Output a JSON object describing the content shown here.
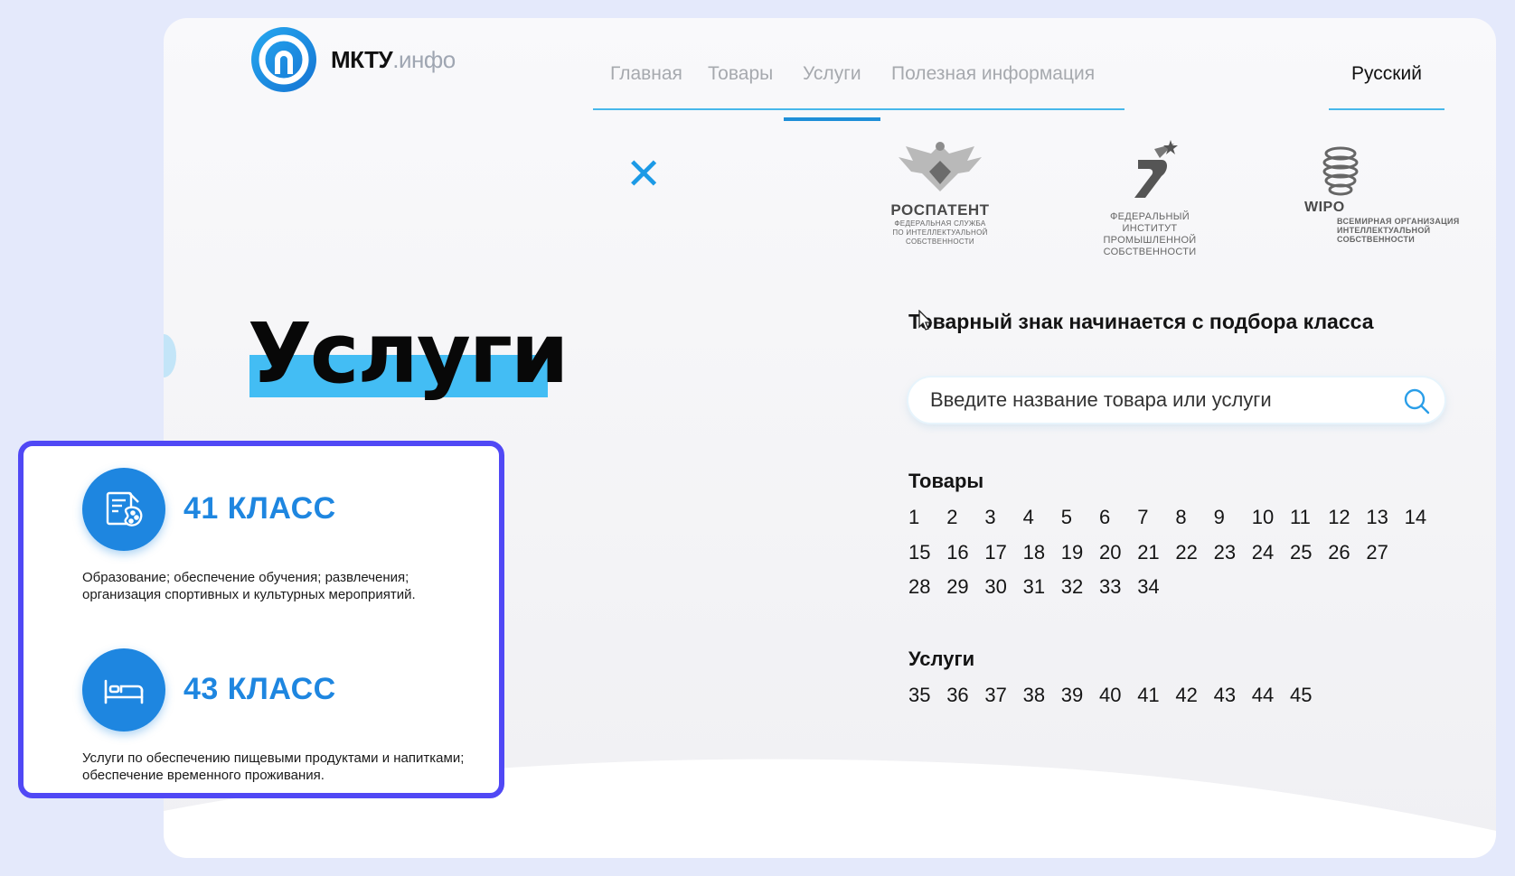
{
  "header": {
    "logo_main": "МКТУ",
    "logo_suffix": ".инфо",
    "nav": [
      "Главная",
      "Товары",
      "Услуги",
      "Полезная информация"
    ],
    "language": "Русский"
  },
  "partners": {
    "rospatent": {
      "name": "РОСПАТЕНТ",
      "sub": [
        "ФЕДЕРАЛЬНАЯ СЛУЖБА",
        "ПО ИНТЕЛЛЕКТУАЛЬНОЙ",
        "СОБСТВЕННОСТИ"
      ]
    },
    "fips": {
      "sub": [
        "ФЕДЕРАЛЬНЫЙ ИНСТИТУТ",
        "ПРОМЫШЛЕННОЙ",
        "СОБСТВЕННОСТИ"
      ]
    },
    "wipo": {
      "name": "WIPO",
      "sub": [
        "ВСЕМИРНАЯ ОРГАНИЗАЦИЯ",
        "ИНТЕЛЛЕКТУАЛЬНОЙ",
        "СОБСТВЕННОСТИ"
      ]
    }
  },
  "hero": {
    "title": "Услуги"
  },
  "search": {
    "tagline": "Товарный знак начинается с подбора класса",
    "placeholder": "Введите название товара или услуги"
  },
  "goods": {
    "heading": "Товары",
    "rows": [
      [
        "1",
        "2",
        "3",
        "4",
        "5",
        "6",
        "7",
        "8",
        "9",
        "10",
        "11",
        "12",
        "13",
        "14"
      ],
      [
        "15",
        "16",
        "17",
        "18",
        "19",
        "20",
        "21",
        "22",
        "23",
        "24",
        "25",
        "26",
        "27"
      ],
      [
        "28",
        "29",
        "30",
        "31",
        "32",
        "33",
        "34"
      ]
    ]
  },
  "services": {
    "heading": "Услуги",
    "rows": [
      [
        "35",
        "36",
        "37",
        "38",
        "39",
        "40",
        "41",
        "42",
        "43",
        "44",
        "45"
      ]
    ]
  },
  "card": {
    "items": [
      {
        "title": "41 КЛАСС",
        "description": "Образование; обеспечение обучения; развлечения; организация спортивных и культурных мероприятий.",
        "icon": "education-art-icon"
      },
      {
        "title": "43 КЛАСС",
        "description": "Услуги по обеспечению пищевыми продуктами и напитками; обеспечение временного проживания.",
        "icon": "bed-icon"
      }
    ]
  },
  "colors": {
    "accent": "#1e86e0",
    "highlight": "#43bdf4",
    "card_border": "#5048f5"
  }
}
